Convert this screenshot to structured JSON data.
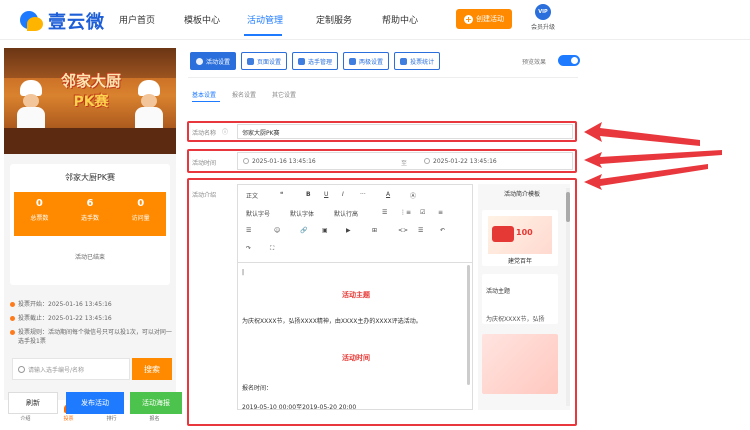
{
  "nav": {
    "brand": "壹云微",
    "items": [
      "用户首页",
      "模板中心",
      "活动管理",
      "定制服务",
      "帮助中心"
    ],
    "create_label": "创建活动",
    "vip_badge": "VIP",
    "upgrade_label": "会员升级"
  },
  "preview": {
    "banner_line1": "邻家大厨",
    "banner_line2": "PK赛",
    "card_title": "邻家大厨PK赛",
    "stats": [
      {
        "value": "0",
        "label": "总票数"
      },
      {
        "value": "6",
        "label": "选手数"
      },
      {
        "value": "0",
        "label": "访问量"
      }
    ],
    "status": "活动已结束",
    "info": [
      "投票开始：2025-01-16 13:45:16",
      "投票截止：2025-01-22 13:45:16",
      "投票规则：活动期间每个微信号只可以投1次，可以对同一选手投1票"
    ],
    "search_placeholder": "请输入选手编号/名称",
    "search_button": "搜索",
    "tabs": [
      "介绍",
      "投票",
      "排行",
      "报名"
    ],
    "active_tab": "投票"
  },
  "actions": {
    "refresh": "刷新",
    "publish": "发布活动",
    "poster": "活动海报"
  },
  "toolbar": {
    "buttons": [
      "活动设置",
      "页面设置",
      "选手管理",
      "两极设置",
      "投票统计"
    ],
    "preview_label": "预览效果",
    "preview_on": true
  },
  "subtabs": [
    "基本设置",
    "报名设置",
    "其它设置"
  ],
  "form": {
    "name_label": "活动名称",
    "name_value": "邻家大厨PK赛",
    "time_label": "活动时间",
    "start": "2025-01-16 13:45:16",
    "to": "至",
    "end": "2025-01-22 13:45:16",
    "intro_label": "活动介绍"
  },
  "editor": {
    "tools_row1": [
      "正文",
      "❝",
      "B",
      "U",
      "I",
      "···",
      "A",
      "Ⓐ"
    ],
    "tools_row2": [
      "默认字号",
      "默认字体",
      "默认行高",
      "☰",
      "⋮≡",
      "☑",
      "≡"
    ],
    "tools_row3": [
      "☰",
      "☺",
      "🔗",
      "▣",
      "▶",
      "⊞",
      "<>",
      "☰",
      "↶"
    ],
    "tools_row4": [
      "↷",
      "⛶"
    ],
    "cursor": "|",
    "heading1": "活动主题",
    "para1": "为庆祝XXXX节，弘扬XXXX精神，由XXXX主办的XXXX评选活动。",
    "heading2": "活动时间",
    "para2": "报名时间：",
    "para3": "2019-05-10 00:00至2019-05-20 20:00"
  },
  "templates": {
    "title": "活动简介模板",
    "items": [
      "建党百年",
      "活动主题",
      "为庆祝XXXX节，弘扬"
    ]
  },
  "colors": {
    "accent": "#1e7bff",
    "orange": "#ff8a00",
    "green": "#4cc34c",
    "highlight": "#e8383d"
  }
}
